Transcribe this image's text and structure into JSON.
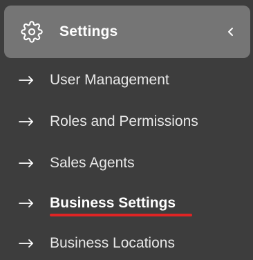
{
  "section": {
    "title": "Settings",
    "gear_icon": "gear-icon",
    "collapse_icon": "chevron-left-icon",
    "background_color": "#757575"
  },
  "menu": {
    "items": [
      {
        "label": "User Management",
        "active": false
      },
      {
        "label": "Roles and Permissions",
        "active": false
      },
      {
        "label": "Sales Agents",
        "active": false
      },
      {
        "label": "Business Settings",
        "active": true
      },
      {
        "label": "Business Locations",
        "active": false
      }
    ],
    "arrow_icon": "arrow-right-icon",
    "highlight_color": "#e02424"
  }
}
